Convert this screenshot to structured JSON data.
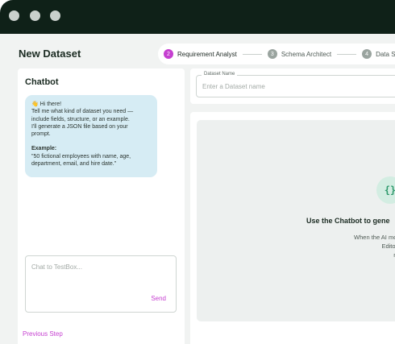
{
  "page": {
    "title": "New Dataset",
    "previous_step": "Previous Step"
  },
  "stepper": {
    "steps": [
      {
        "number": "2",
        "label": "Requirement Analyst",
        "active": true
      },
      {
        "number": "3",
        "label": "Schema Architect",
        "active": false
      },
      {
        "number": "4",
        "label": "Data Synth",
        "active": false
      }
    ]
  },
  "chatbot": {
    "title": "Chatbot",
    "message": {
      "greeting": "👋 Hi there!",
      "line1": "Tell me what kind of dataset you need —",
      "line2": "include fields, structure, or an example.",
      "line3": " I'll generate a JSON file based on your",
      "line4": "prompt.",
      "example_label": "Example:",
      "example_line1": " \"50 fictional employees with name, age,",
      "example_line2": "department, email, and hire date.\""
    },
    "input_placeholder": "Chat to TestBox...",
    "send_label": "Send"
  },
  "dataset_name": {
    "label": "Dataset Name",
    "placeholder": "Enter a Dataset name"
  },
  "editor": {
    "icon": "{}",
    "empty_title": "Use the Chatbot to gene",
    "empty_line1": "When the AI model gives yo",
    "empty_line2": "Editor\" to see it in",
    "empty_line3": "make small c"
  },
  "colors": {
    "accent": "#c53fd0",
    "bubble": "#d6ecf4",
    "json_icon": "#2f9a6d",
    "window_chrome": "#0f2118"
  }
}
